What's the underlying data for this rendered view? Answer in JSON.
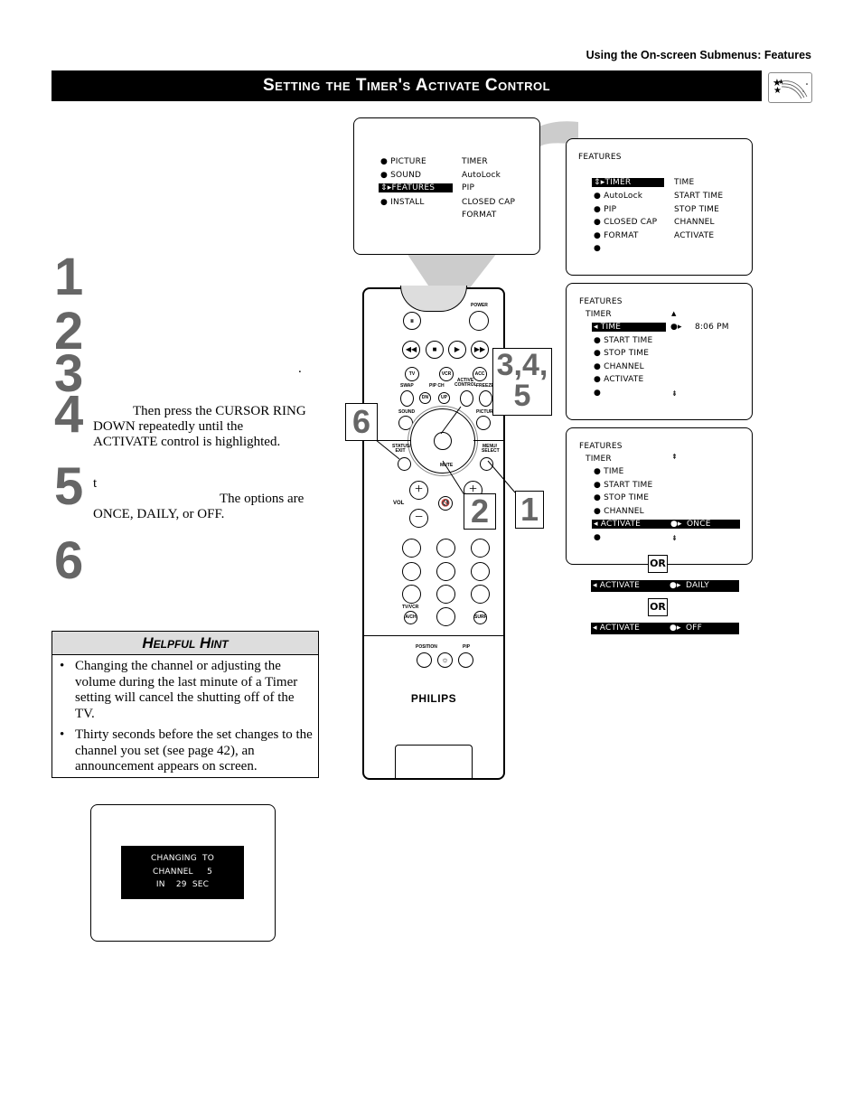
{
  "header": {
    "section_label": "Using the On-screen Submenus: Features",
    "title": "Setting the Timer's Activate Control",
    "title_icon": "shooting-stars-icon"
  },
  "steps": [
    {
      "number": "1",
      "text": ""
    },
    {
      "number": "2",
      "text": ""
    },
    {
      "number": "3",
      "text": "."
    },
    {
      "number": "4",
      "text": "Then press the CURSOR RING DOWN repeatedly until the ACTIVATE control is highlighted."
    },
    {
      "number": "5",
      "text_line1": "t",
      "text_line2": "The options are",
      "text_line3": "ONCE, DAILY, or OFF."
    },
    {
      "number": "6",
      "text": ""
    }
  ],
  "hint": {
    "title": "Helpful Hint",
    "items": [
      "Changing the channel or adjusting the volume during the last minute of a Timer setting will cancel the shutting off of the TV.",
      "Thirty seconds before the set changes to the channel you set (see page 42), an announcement appears on screen."
    ]
  },
  "screen_main_menu": {
    "left_items": [
      "PICTURE",
      "SOUND",
      "FEATURES",
      "INSTALL"
    ],
    "selected": "FEATURES",
    "right_items": [
      "TIMER",
      "AutoLock",
      "PIP",
      "CLOSED CAP",
      "FORMAT"
    ]
  },
  "screen_features": {
    "title": "FEATURES",
    "left_items": [
      "TIMER",
      "AutoLock",
      "PIP",
      "CLOSED CAP",
      "FORMAT",
      ""
    ],
    "selected": "TIMER",
    "right_items": [
      "TIME",
      "START TIME",
      "STOP TIME",
      "CHANNEL",
      "ACTIVATE"
    ]
  },
  "screen_timer": {
    "title": "FEATURES",
    "subtitle": "TIMER",
    "items": [
      "TIME",
      "START TIME",
      "STOP TIME",
      "CHANNEL",
      "ACTIVATE",
      ""
    ],
    "selected": "TIME",
    "value": "8:06 PM"
  },
  "screen_activate": {
    "title": "FEATURES",
    "subtitle": "TIMER",
    "items": [
      "TIME",
      "START TIME",
      "STOP TIME",
      "CHANNEL",
      "ACTIVATE",
      ""
    ],
    "selected": "ACTIVATE",
    "value": "ONCE"
  },
  "activate_options": {
    "or_label": "OR",
    "option_label": "ACTIVATE",
    "alt_values": [
      "DAILY",
      "OFF"
    ]
  },
  "screen_announcement": {
    "line1": "CHANGING  TO",
    "line2": "CHANNEL     5",
    "line3": "IN    29  SEC"
  },
  "remote": {
    "brand": "PHILIPS",
    "labels": {
      "power": "POWER",
      "tv": "TV",
      "vcr": "VCR",
      "acc": "ACC",
      "swap": "SWAP",
      "pip_ch": "PIP CH",
      "active_control": "ACTIVE CONTROL",
      "freeze": "FREEZE",
      "dn": "DN",
      "up": "UP",
      "sound": "SOUND",
      "picture": "PICTURE",
      "status_exit": "STATUS/ EXIT",
      "menu_select": "MENU/ SELECT",
      "vol": "VOL",
      "mute": "MUTE",
      "tv_vcr": "TV/VCR",
      "a_ch": "A/CH",
      "surf": "SURF",
      "position": "POSITION",
      "pip": "PIP"
    }
  },
  "callouts": {
    "c1": "1",
    "c2": "2",
    "c345_line1": "3,4,",
    "c345_line2": "5",
    "c6": "6"
  }
}
